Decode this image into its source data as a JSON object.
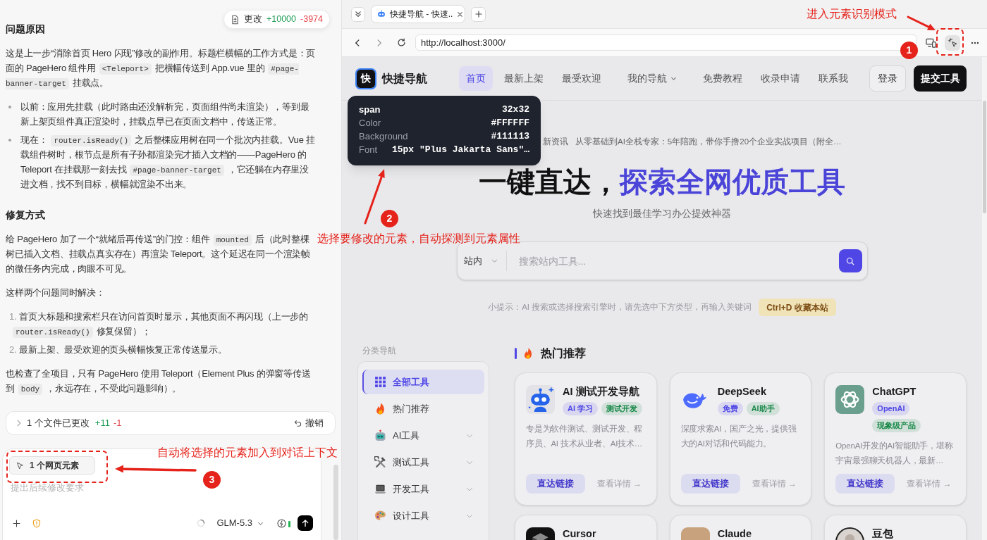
{
  "chat": {
    "changes": {
      "label": "更改",
      "added": "+10000",
      "removed": "-3974"
    },
    "blocks": [
      {
        "kind": "heading",
        "text": "问题原因"
      },
      {
        "kind": "paragraph",
        "parts": [
          {
            "kind": "text",
            "text": "这是上一步“消除首页 Hero 闪现”修改的副作用。标题栏横幅的工作方式是：页面的 PageHero 组件用"
          },
          {
            "kind": "code",
            "text": "<Teleport>"
          },
          {
            "kind": "text",
            "text": "把横幅传送到 App.vue 里的"
          },
          {
            "kind": "code",
            "text": "#page-banner-target"
          },
          {
            "kind": "text",
            "text": "挂载点。"
          }
        ]
      },
      {
        "kind": "bullets",
        "items": [
          {
            "parts": [
              {
                "kind": "text",
                "text": "以前：应用先挂载（此时路由还没解析完，页面组件尚未渲染），等到最新上架页组件真正渲染时，挂载点早已在页面文档中，传送正常。"
              }
            ]
          },
          {
            "parts": [
              {
                "kind": "text",
                "text": "现在："
              },
              {
                "kind": "code",
                "text": "router.isReady()"
              },
              {
                "kind": "text",
                "text": "之后整棵应用树在同一个批次内挂载。Vue 挂载组件树时，根节点是所有子孙都渲染完才插入文档的——PageHero 的 Teleport 在挂载那一刻去找"
              },
              {
                "kind": "code",
                "text": "#page-banner-target"
              },
              {
                "kind": "text",
                "text": "，它还躺在内存里没进文档，找不到目标，横幅就渲染不出来。"
              }
            ]
          }
        ]
      },
      {
        "kind": "heading",
        "text": "修复方式"
      },
      {
        "kind": "paragraph",
        "parts": [
          {
            "kind": "text",
            "text": "给 PageHero 加了一个“就绪后再传送”的门控：组件"
          },
          {
            "kind": "code",
            "text": "mounted"
          },
          {
            "kind": "text",
            "text": "后（此时整棵树已插入文档、挂载点真实存在）再渲染 Teleport。这个延迟在同一个渲染帧的微任务内完成，肉眼不可见。"
          }
        ]
      },
      {
        "kind": "paragraph",
        "parts": [
          {
            "kind": "text",
            "text": "这样两个问题同时解决："
          }
        ]
      },
      {
        "kind": "numbered",
        "items": [
          {
            "number": "1.",
            "parts": [
              {
                "kind": "text",
                "text": "首页大标题和搜索栏只在访问首页时显示，其他页面不再闪现（上一步的"
              },
              {
                "kind": "code",
                "text": "router.isReady()"
              },
              {
                "kind": "text",
                "text": "修复保留）；"
              }
            ]
          },
          {
            "number": "2.",
            "parts": [
              {
                "kind": "text",
                "text": "最新上架、最受欢迎的页头横幅恢复正常传送显示。"
              }
            ]
          }
        ]
      },
      {
        "kind": "paragraph",
        "parts": [
          {
            "kind": "text",
            "text": "也检查了全项目，只有 PageHero 使用 Teleport（Element Plus 的弹窗等传送到"
          },
          {
            "kind": "code",
            "text": "body"
          },
          {
            "kind": "text",
            "text": "，永远存在，不受此问题影响）。"
          }
        ]
      }
    ],
    "changed_files": {
      "label": "1 个文件已更改",
      "added": "+11",
      "removed": "-1",
      "undo": "撤销"
    },
    "composer": {
      "context_chip": "1 个网页元素",
      "placeholder": "提出后续修改要求",
      "model": "GLM-5.3"
    }
  },
  "browser": {
    "tabs": [
      {
        "title": "快捷导航 - 快速..",
        "selected": true
      }
    ],
    "url": "http://localhost:3000/",
    "picker_active": true,
    "page": {
      "header": {
        "logo": "快",
        "site_name": "快捷导航",
        "nav": [
          {
            "label": "首页",
            "selected": true,
            "has_menu": false
          },
          {
            "label": "最新上架",
            "selected": false,
            "has_menu": false
          },
          {
            "label": "最受欢迎",
            "selected": false,
            "has_menu": false
          },
          {
            "label": "我的导航",
            "selected": false,
            "has_menu": true
          },
          {
            "label": "免费教程",
            "selected": false,
            "has_menu": false
          },
          {
            "label": "收录申请",
            "selected": false,
            "has_menu": false
          },
          {
            "label": "联系我",
            "selected": false,
            "has_menu": false
          }
        ],
        "login": "登录",
        "submit": "提交工具"
      },
      "inspector": {
        "tag": "span",
        "size": "32x32",
        "rows": [
          {
            "label": "Color",
            "value": "#FFFFFF"
          },
          {
            "label": "Background",
            "value": "#111113"
          },
          {
            "label": "Font",
            "value": "15px \"Plus Jakarta Sans\"…"
          }
        ]
      },
      "ticker": {
        "label": "新资讯",
        "text": "从零基础到AI全栈专家：5年陪跑，带你手撸20个企业实战项目（附全…"
      },
      "hero": {
        "title": "一键直达，",
        "title_accent": "探索全网优质工具",
        "subtitle": "快速找到最佳学习办公提效神器"
      },
      "search": {
        "scope": "站内",
        "placeholder": "搜索站内工具..."
      },
      "hint": {
        "text": "小提示：AI 搜索或选择搜索引擎时，请先选中下方类型，再输入关键词",
        "shortcut": "Ctrl+D 收藏本站"
      },
      "categories": {
        "title": "分类导航",
        "items": [
          {
            "label": "全部工具",
            "selected": true,
            "expandable": false
          },
          {
            "label": "热门推荐",
            "selected": false,
            "expandable": false
          },
          {
            "label": "AI工具",
            "selected": false,
            "expandable": true
          },
          {
            "label": "测试工具",
            "selected": false,
            "expandable": true
          },
          {
            "label": "开发工具",
            "selected": false,
            "expandable": true
          },
          {
            "label": "设计工具",
            "selected": false,
            "expandable": true
          }
        ]
      },
      "section": {
        "title": "热门推荐"
      },
      "tools": [
        {
          "name": "AI 测试开发导航",
          "tags": [
            {
              "text": "AI 学习",
              "color": "#4f46e5"
            },
            {
              "text": "测试开发",
              "color": "#1a8a4a"
            }
          ],
          "description": "专是为软件测试、测试开发、程序员、AI 技术从业者、AI技术…",
          "visit": "直达链接",
          "details": "查看详情 →"
        },
        {
          "name": "DeepSeek",
          "tags": [
            {
              "text": "免费",
              "color": "#4f46e5"
            },
            {
              "text": "AI助手",
              "color": "#1a8a4a"
            }
          ],
          "description": "深度求索AI，国产之光，提供强大的AI对话和代码能力。",
          "visit": "直达链接",
          "details": "查看详情 →"
        },
        {
          "name": "ChatGPT",
          "tags": [
            {
              "text": "OpenAI",
              "color": "#4f46e5"
            },
            {
              "text": "现象级产品",
              "color": "#1a8a4a"
            }
          ],
          "description": "OpenAI开发的AI智能助手，堪称宇宙最强聊天机器人，最新…",
          "visit": "直达链接",
          "details": "查看详情 →"
        },
        {
          "name": "Cursor"
        },
        {
          "name": "Claude"
        },
        {
          "name": "豆包"
        }
      ]
    }
  },
  "annotations": [
    {
      "number": "1",
      "text": "进入元素识别模式",
      "framed": true
    },
    {
      "number": "2",
      "text": "选择要修改的元素，自动探测到元素属性",
      "framed": false
    },
    {
      "number": "3",
      "text": "自动将选择的元素加入到对话上下文",
      "framed": true
    }
  ]
}
